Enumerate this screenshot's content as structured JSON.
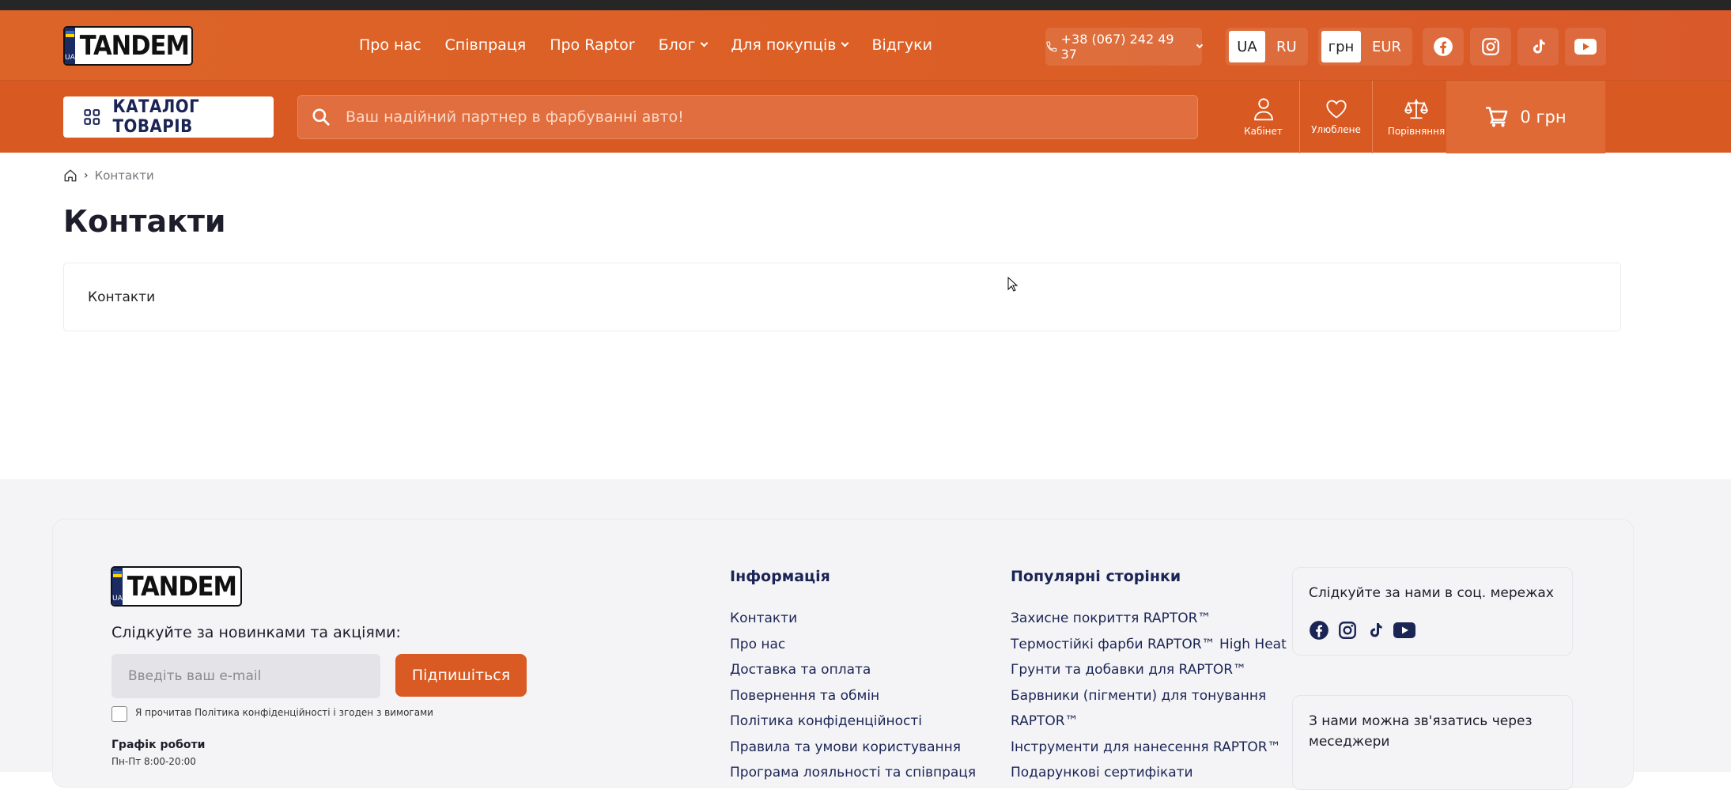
{
  "brand": {
    "logo_text": "TANDEM",
    "logo_country": "UA"
  },
  "nav": {
    "items": [
      {
        "label": "Про нас",
        "dropdown": false
      },
      {
        "label": "Співпраця",
        "dropdown": false
      },
      {
        "label": "Про Raptor",
        "dropdown": false
      },
      {
        "label": "Блог",
        "dropdown": true
      },
      {
        "label": "Для покупців",
        "dropdown": true
      },
      {
        "label": "Відгуки",
        "dropdown": false
      }
    ]
  },
  "phone": "+38 (067) 242 49 37",
  "languages": {
    "options": [
      "UA",
      "RU"
    ],
    "active": "UA"
  },
  "currency": {
    "options": [
      "грн",
      "EUR"
    ],
    "active": "грн"
  },
  "social_header": [
    "facebook-icon",
    "instagram-icon",
    "tiktok-icon",
    "youtube-icon"
  ],
  "catalog_button": "КАТАЛОГ ТОВАРІВ",
  "search": {
    "placeholder": "Ваш надійний партнер в фарбуванні авто!"
  },
  "header_actions": {
    "account": "Кабінет",
    "favorites": "Улюблене",
    "compare": "Порівняння"
  },
  "cart": {
    "total": "0 грн"
  },
  "breadcrumb": {
    "current": "Контакти"
  },
  "page": {
    "title": "Контакти",
    "card_text": "Контакти"
  },
  "footer": {
    "subscribe_label": "Слідкуйте за новинками та акціями:",
    "email_placeholder": "Введіть ваш e-mail",
    "subscribe_button": "Підпишіться",
    "consent_text": "Я прочитав Політика конфіденційності і згоден з вимогами",
    "schedule_title": "Графік роботи",
    "schedule_value": "Пн-Пт 8:00-20:00",
    "info_title": "Інформація",
    "info_links": [
      "Контакти",
      "Про нас",
      "Доставка та оплата",
      "Повернення та обмін",
      "Політика конфіденційності",
      "Правила та умови користування",
      "Програма лояльності та співпраця"
    ],
    "popular_title": "Популярні сторінки",
    "popular_links": [
      "Захисне покриття RAPTOR™",
      "Термостійкі фарби RAPTOR™ High Heat",
      "Грунти та добавки для RAPTOR™",
      "Барвники (пігменти) для тонування",
      "RAPTOR™",
      "Інструменти для нанесення RAPTOR™",
      "Подарункові сертифікати"
    ],
    "social_title": "Слідкуйте за нами в соц. мережах",
    "messengers_line1": "З нами можна зв'язатись через",
    "messengers_line2": "меседжери"
  },
  "colors": {
    "brand_orange": "#d95a23",
    "navy": "#1b2555"
  }
}
